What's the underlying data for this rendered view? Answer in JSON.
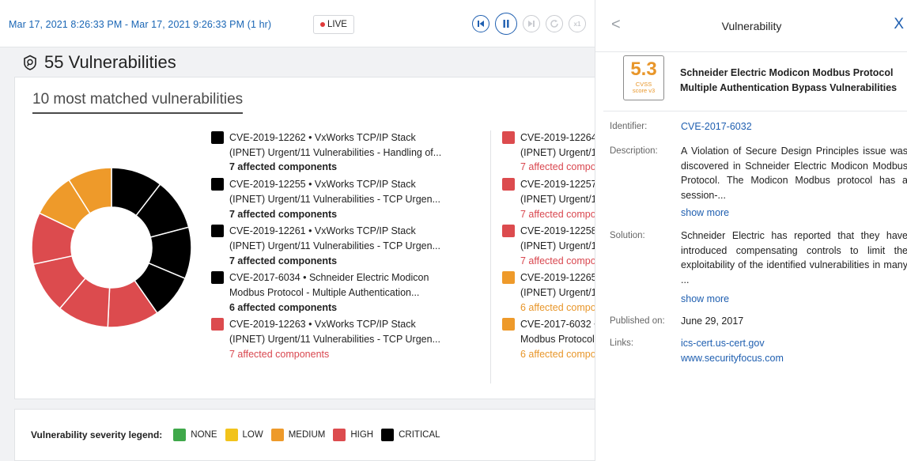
{
  "timebar": {
    "range": "Mar 17, 2021 8:26:33 PM - Mar 17, 2021 9:26:33 PM  (1 hr)",
    "live": "LIVE",
    "controls": [
      "skip-back",
      "pause",
      "skip-forward",
      "refresh",
      "speed-x1"
    ],
    "speed_label": "x1"
  },
  "main": {
    "title": "55 Vulnerabilities",
    "card_title": "10 most matched vulnerabilities",
    "vulnerabilities_col1": [
      {
        "line1": "CVE-2019-12262 • VxWorks TCP/IP Stack",
        "line2": "(IPNET) Urgent/11 Vulnerabilities - Handling of...",
        "count": "7 affected components",
        "severity": "critical"
      },
      {
        "line1": "CVE-2019-12255 • VxWorks TCP/IP Stack",
        "line2": "(IPNET) Urgent/11 Vulnerabilities - TCP Urgen...",
        "count": "7 affected components",
        "severity": "critical"
      },
      {
        "line1": "CVE-2019-12261 • VxWorks TCP/IP Stack",
        "line2": "(IPNET) Urgent/11 Vulnerabilities - TCP Urgen...",
        "count": "7 affected components",
        "severity": "critical"
      },
      {
        "line1": "CVE-2017-6034 • Schneider Electric Modicon",
        "line2": "Modbus Protocol - Multiple Authentication...",
        "count": "6 affected components",
        "severity": "critical"
      },
      {
        "line1": "CVE-2019-12263 • VxWorks TCP/IP Stack",
        "line2": "(IPNET) Urgent/11 Vulnerabilities - TCP Urgen...",
        "count": "7 affected components",
        "severity": "high"
      }
    ],
    "vulnerabilities_col2": [
      {
        "line1": "CVE-2019-12264",
        "line2": "(IPNET) Urgent/1",
        "count": "7 affected compo",
        "severity": "high"
      },
      {
        "line1": "CVE-2019-12257",
        "line2": "(IPNET) Urgent/1",
        "count": "7 affected compo",
        "severity": "high"
      },
      {
        "line1": "CVE-2019-12258",
        "line2": "(IPNET) Urgent/1",
        "count": "7 affected compo",
        "severity": "high"
      },
      {
        "line1": "CVE-2019-12265",
        "line2": "(IPNET) Urgent/1",
        "count": "6 affected compo",
        "severity": "medium"
      },
      {
        "line1": "CVE-2017-6032 •",
        "line2": "Modbus Protocol",
        "count": "6 affected compo",
        "severity": "medium"
      }
    ],
    "donut_segments": [
      {
        "severity": "critical",
        "value": 7
      },
      {
        "severity": "critical",
        "value": 7
      },
      {
        "severity": "critical",
        "value": 7
      },
      {
        "severity": "critical",
        "value": 6
      },
      {
        "severity": "high",
        "value": 7
      },
      {
        "severity": "high",
        "value": 7
      },
      {
        "severity": "high",
        "value": 7
      },
      {
        "severity": "high",
        "value": 7
      },
      {
        "severity": "medium",
        "value": 6
      },
      {
        "severity": "medium",
        "value": 6
      }
    ],
    "legend": {
      "title": "Vulnerability severity legend:",
      "items": [
        {
          "label": "NONE",
          "color": "#3fa84a"
        },
        {
          "label": "LOW",
          "color": "#f2c31b"
        },
        {
          "label": "MEDIUM",
          "color": "#ee9a2a"
        },
        {
          "label": "HIGH",
          "color": "#dc4b4e"
        },
        {
          "label": "CRITICAL",
          "color": "#000000"
        }
      ]
    }
  },
  "colors": {
    "critical": "#000000",
    "high": "#dc4b4e",
    "medium": "#ee9a2a",
    "accent": "#1f5fb0"
  },
  "panel": {
    "title": "Vulnerability",
    "score": "5.3",
    "score_label_1": "CVSS",
    "score_label_2": "score v3",
    "name": "Schneider Electric Modicon Modbus Protocol Multiple Authentication Bypass Vulnerabilities",
    "identifier_label": "Identifier:",
    "identifier": "CVE-2017-6032",
    "description_label": "Description:",
    "description": "A Violation of Secure Design Principles issue was discovered in Schneider Electric Modicon Modbus Protocol. The Modicon Modbus protocol has a session-...",
    "show_more_1": "show more",
    "solution_label": "Solution:",
    "solution": "Schneider Electric has reported that they have introduced compensating controls to limit the exploitability of the identified vulnerabilities in many ...",
    "show_more_2": "show more",
    "published_label": "Published on:",
    "published": "June 29, 2017",
    "links_label": "Links:",
    "link_1": "ics-cert.us-cert.gov",
    "link_2": "www.securityfocus.com"
  }
}
